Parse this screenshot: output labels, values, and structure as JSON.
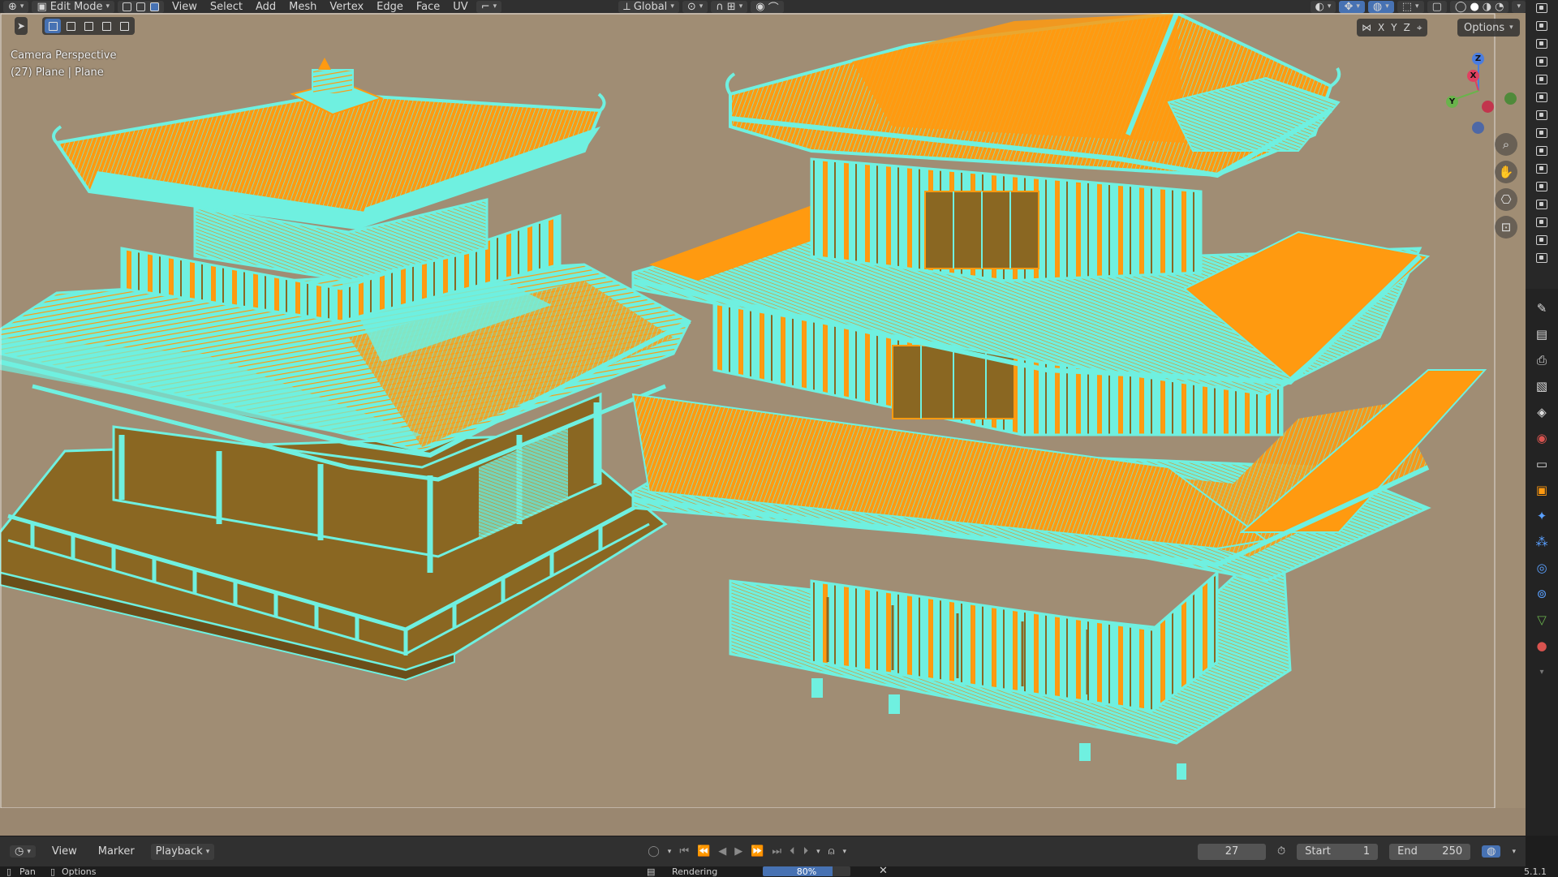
{
  "header": {
    "mode": "Edit Mode",
    "menus": [
      "View",
      "Select",
      "Add",
      "Mesh",
      "Vertex",
      "Edge",
      "Face",
      "UV"
    ],
    "orientation": "Global"
  },
  "viewport": {
    "view_name": "Camera Perspective",
    "object_info": "(27) Plane | Plane",
    "options_label": "Options",
    "axis_toggles": [
      "X",
      "Y",
      "Z"
    ],
    "gizmo_axes": {
      "z": "Z",
      "x": "X",
      "y": "Y"
    },
    "colors": {
      "background": "#a08d74",
      "selected_face": "#ff9a10",
      "edge": "#6ff0e0",
      "unselected_face": "#8a6722"
    }
  },
  "timeline": {
    "menus": [
      "View",
      "Marker",
      "Playback"
    ],
    "current_frame": "27",
    "start_label": "Start",
    "start_value": "1",
    "end_label": "End",
    "end_value": "250"
  },
  "statusbar": {
    "left_items": [
      "Pan",
      "Options"
    ],
    "job_label": "Rendering",
    "progress_text": "80%",
    "progress_value": 0.8,
    "version": "5.1.1"
  },
  "icons": {
    "gizmo": [
      "zoom-icon",
      "hand-icon",
      "camera-icon",
      "lock-icon"
    ],
    "properties": [
      "tool-icon",
      "render-icon",
      "output-icon",
      "view-layer-icon",
      "scene-icon",
      "world-icon",
      "collection-icon",
      "object-icon",
      "modifier-icon",
      "particles-icon",
      "physics-icon",
      "constraints-icon",
      "data-icon",
      "material-icon"
    ]
  }
}
